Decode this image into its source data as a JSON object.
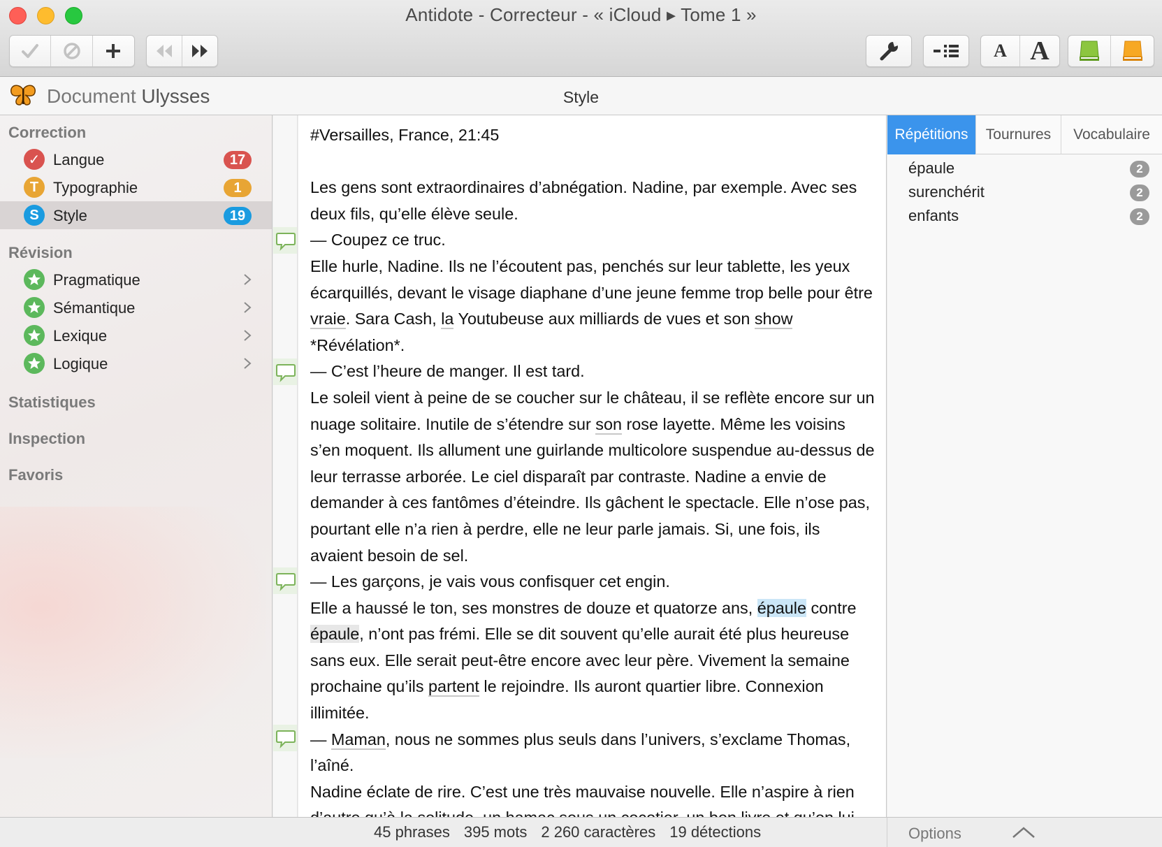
{
  "window": {
    "title": "Antidote - Correcteur - « iCloud ▸ Tome 1 »"
  },
  "toolbar": {
    "icons": [
      "checkmark-icon",
      "ignore-icon",
      "plus-icon",
      "rewind-icon",
      "fast-forward-icon",
      "wrench-icon",
      "outline-icon",
      "font-small-icon",
      "font-large-icon",
      "dictionary-green-icon",
      "guide-orange-icon"
    ],
    "font_small": "A",
    "font_large": "A"
  },
  "header": {
    "doc_prefix": "Document",
    "doc_app": "Ulysses",
    "section": "Style"
  },
  "sidebar": {
    "correction_heading": "Correction",
    "correction_items": [
      {
        "label": "Langue",
        "icon": "✓",
        "icon_color": "#d9534f",
        "count": "17",
        "badge_color": "#d9534f"
      },
      {
        "label": "Typographie",
        "icon": "T",
        "icon_color": "#e8a534",
        "count": "1",
        "badge_color": "#e8a534"
      },
      {
        "label": "Style",
        "icon": "S",
        "icon_color": "#1a9be0",
        "count": "19",
        "badge_color": "#1a9be0"
      }
    ],
    "revision_heading": "Révision",
    "revision_items": [
      {
        "label": "Pragmatique"
      },
      {
        "label": "Sémantique"
      },
      {
        "label": "Lexique"
      },
      {
        "label": "Logique"
      }
    ],
    "statistics": "Statistiques",
    "inspection": "Inspection",
    "favorites": "Favoris"
  },
  "document": {
    "heading": "#Versailles, France, 21:45",
    "p1": "Les gens sont extraordinaires d’abnégation. Nadine, par exemple. Avec ses deux fils, qu’elle élève seule.",
    "p2": "— Coupez ce truc.",
    "p3_a": "Elle hurle, Nadine. Ils ne l’écoutent pas, penchés sur leur tablette, les yeux écarquillés, devant le visage diaphane d’une jeune femme trop belle pour être ",
    "p3_vraie": "vraie",
    "p3_b": ". Sara Cash, ",
    "p3_la": "la",
    "p3_c": " Youtubeuse aux milliards de vues et son ",
    "p3_show": "show",
    "p3_d": " *Révélation*.",
    "p4": "— C’est l’heure de manger. Il est tard.",
    "p5_a": "Le soleil vient à peine de se coucher sur le château, il se reflète encore sur un nuage solitaire. Inutile de s’étendre sur ",
    "p5_son": "son",
    "p5_b": " rose layette. Même les voisins s’en moquent. Ils allument une guirlande multicolore suspendue au-dessus de leur terrasse arborée. Le ciel disparaît par contraste. Nadine a envie de demander à ces fantômes d’éteindre. Ils gâchent le spectacle. Elle n’ose pas, pourtant elle n’a rien à perdre, elle ne leur parle jamais. Si, une fois, ils avaient besoin de sel.",
    "p6": "— Les garçons, je vais vous confisquer cet engin.",
    "p7_a": "Elle a haussé le ton, ses monstres de douze et quatorze ans, ",
    "p7_epaule1": "épaule",
    "p7_b": " contre ",
    "p7_epaule2": "épaule",
    "p7_c": ", n’ont pas frémi. Elle se dit souvent qu’elle aurait été plus heureuse sans eux. Elle serait peut-être encore avec leur père. Vivement la semaine prochaine qu’ils ",
    "p7_partent": "partent",
    "p7_d": " le rejoindre. Ils auront quartier libre. Connexion illimitée.",
    "p8_a": "— ",
    "p8_maman": "Maman",
    "p8_b": ", nous ne sommes plus seuls dans l’univers, s’exclame Thomas, l’aîné.",
    "p9": "Nadine éclate de rire. C’est une très mauvaise nouvelle. Elle n’aspire à rien d’autre qu’à la solitude, un hamac sous un cocotier, un bon livre et qu’on lui"
  },
  "rightpanel": {
    "tabs": [
      "Répétitions",
      "Tournures",
      "Vocabulaire"
    ],
    "active_tab": "Répétitions",
    "repetitions": [
      {
        "word": "épaule",
        "count": "2"
      },
      {
        "word": "surenchérit",
        "count": "2"
      },
      {
        "word": "enfants",
        "count": "2"
      }
    ]
  },
  "statusbar": {
    "phrases": "45 phrases",
    "mots": "395 mots",
    "caracteres": "2 260 caractères",
    "detections": "19 détections",
    "options": "Options"
  },
  "colors": {
    "accent": "#3b94ec",
    "comment_mark": "#7cb35a"
  }
}
